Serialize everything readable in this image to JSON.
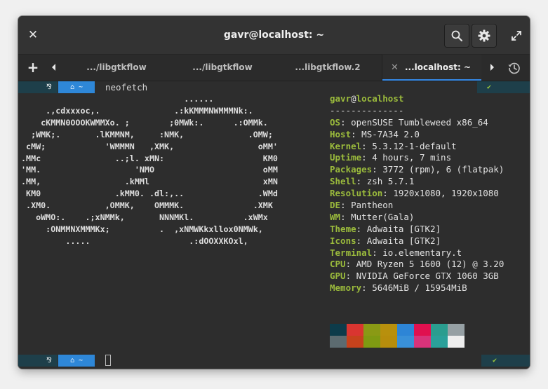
{
  "window": {
    "title": "gavr@localhost: ~",
    "close_glyph": "✕",
    "search_icon": "search-icon",
    "settings_icon": "gear-icon",
    "fullscreen_icon": "maximize-icon"
  },
  "tabs": {
    "add_glyph": "+",
    "items": [
      {
        "label": ".../libgtkflow"
      },
      {
        "label": ".../libgtkflow"
      },
      {
        "label": "...libgtkflow.2"
      },
      {
        "label": "...localhost: ~",
        "active": true
      }
    ],
    "close_glyph": "✕"
  },
  "prompt": {
    "os_glyph": "⅋",
    "home_glyph": "⌂",
    "dir": "~",
    "ok_glyph": "✔",
    "command": "neofetch"
  },
  "logo_lines": [
    "                                 ......",
    "     .,cdxxxoc,.               .:kKMMMNWMMMNk:.",
    "    cKMMN0OOOKWMMXo. ;        ;0MWk:.      .:OMMk.",
    "  ;WMK;.       .lKMMNM,     :NMK,             .OMW;",
    " cMW;            'WMMMN   ,XMK,                 oMM'",
    ".MMc               ..;l. xMN:                    KM0",
    "'MM.                   'NMO                      oMM",
    ".MM,                 .kMMl                       xMN",
    " KM0               .kMM0. .dl:,..               .WMd",
    " .XM0.           ,OMMK,    OMMMK.              .XMK",
    "   oWMO:.    .;xNMMk,       NNNMKl.          .xWMx",
    "     :ONMMNXMMMKx;          .  ,xNMWKkxllox0NMWk,",
    "         .....                    .:dOOXXKOxl,"
  ],
  "info": {
    "user": "gavr",
    "at": "@",
    "host": "localhost",
    "separator": "--------------",
    "fields": [
      {
        "key": "OS",
        "value": "openSUSE Tumbleweed x86_64"
      },
      {
        "key": "Host",
        "value": "MS-7A34 2.0"
      },
      {
        "key": "Kernel",
        "value": "5.3.12-1-default"
      },
      {
        "key": "Uptime",
        "value": "4 hours, 7 mins"
      },
      {
        "key": "Packages",
        "value": "3772 (rpm), 6 (flatpak)"
      },
      {
        "key": "Shell",
        "value": "zsh 5.7.1"
      },
      {
        "key": "Resolution",
        "value": "1920x1080, 1920x1080"
      },
      {
        "key": "DE",
        "value": "Pantheon"
      },
      {
        "key": "WM",
        "value": "Mutter(Gala)"
      },
      {
        "key": "Theme",
        "value": "Adwaita [GTK2]"
      },
      {
        "key": "Icons",
        "value": "Adwaita [GTK2]"
      },
      {
        "key": "Terminal",
        "value": "io.elementary.t"
      },
      {
        "key": "CPU",
        "value": "AMD Ryzen 5 1600 (12) @ 3.20"
      },
      {
        "key": "GPU",
        "value": "NVIDIA GeForce GTX 1060 3GB"
      },
      {
        "key": "Memory",
        "value": "5646MiB / 15954MiB"
      }
    ]
  },
  "palette": {
    "row1": [
      "#0d3b4a",
      "#d93530",
      "#8a9a15",
      "#b8900d",
      "#2d85d6",
      "#e0104f",
      "#2a9d8f",
      "#96a0a4"
    ],
    "row2": [
      "#5c6b70",
      "#c6421c",
      "#7f9a12",
      "#b78d0c",
      "#3990d8",
      "#d8337a",
      "#2aa09a",
      "#eeeeee"
    ]
  }
}
